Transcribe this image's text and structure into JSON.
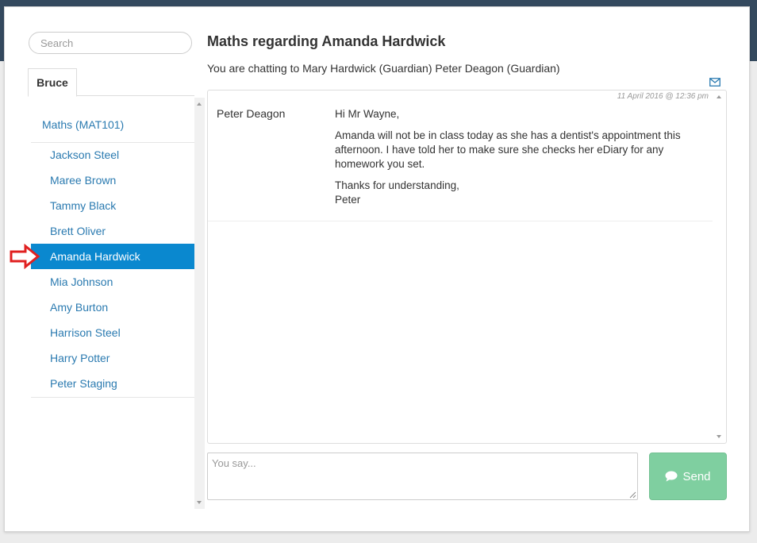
{
  "search": {
    "placeholder": "Search"
  },
  "tabs": [
    {
      "label": "Bruce",
      "active": true
    }
  ],
  "subject": {
    "label": "Maths (MAT101)"
  },
  "students": [
    {
      "name": "Jackson Steel",
      "active": false
    },
    {
      "name": "Maree Brown",
      "active": false
    },
    {
      "name": "Tammy Black",
      "active": false
    },
    {
      "name": "Brett Oliver",
      "active": false
    },
    {
      "name": "Amanda Hardwick",
      "active": true
    },
    {
      "name": "Mia Johnson",
      "active": false
    },
    {
      "name": "Amy Burton",
      "active": false
    },
    {
      "name": "Harrison Steel",
      "active": false
    },
    {
      "name": "Harry Potter",
      "active": false
    },
    {
      "name": "Peter Staging",
      "active": false
    }
  ],
  "chat": {
    "title": "Maths regarding Amanda Hardwick",
    "participants": "You are chatting to Mary Hardwick (Guardian) Peter Deagon (Guardian)",
    "messages": [
      {
        "timestamp": "11 April 2016 @ 12:36 pm",
        "sender": "Peter Deagon",
        "paragraphs": [
          "Hi Mr Wayne,",
          "Amanda will not be in class today as she has a dentist's appointment this afternoon. I have told her to make sure she checks her eDiary for any homework you set.",
          "Thanks for understanding,",
          "Peter"
        ]
      }
    ]
  },
  "compose": {
    "placeholder": "You say..."
  },
  "send": {
    "label": "Send",
    "icon": "chat-bubble-icon"
  },
  "colors": {
    "topbar": "#34495e",
    "accent": "#0a88cf",
    "link": "#2a7ab0",
    "send_button": "#7fcfa0",
    "marker_arrow": "#e02020"
  }
}
